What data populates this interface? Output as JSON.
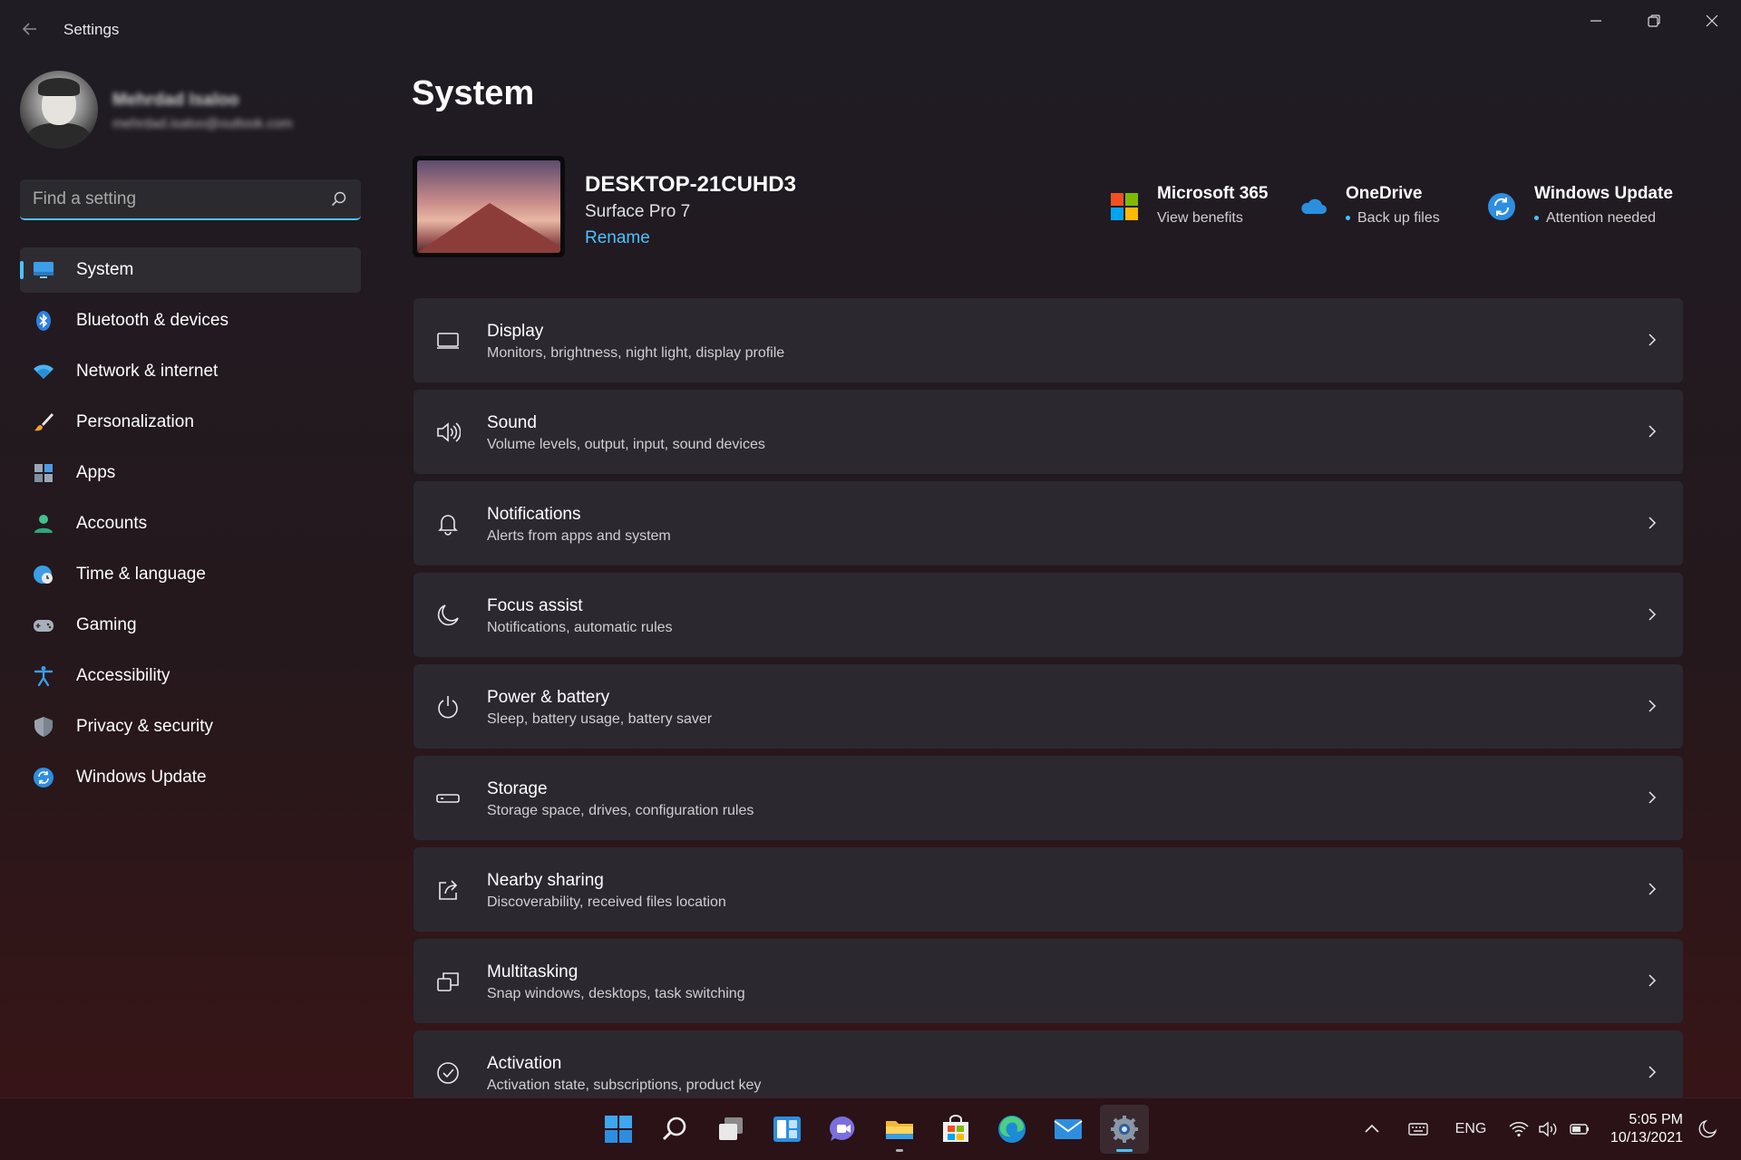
{
  "window": {
    "title": "Settings"
  },
  "profile": {
    "name": "Mehrdad Isaloo",
    "email": "mehrdad.isaloo@outlook.com"
  },
  "search": {
    "placeholder": "Find a setting",
    "value": ""
  },
  "sidebar": {
    "items": [
      {
        "label": "System",
        "icon": "system-icon",
        "active": true
      },
      {
        "label": "Bluetooth & devices",
        "icon": "bluetooth-icon"
      },
      {
        "label": "Network & internet",
        "icon": "wifi-icon"
      },
      {
        "label": "Personalization",
        "icon": "brush-icon"
      },
      {
        "label": "Apps",
        "icon": "apps-icon"
      },
      {
        "label": "Accounts",
        "icon": "account-icon"
      },
      {
        "label": "Time & language",
        "icon": "globe-clock-icon"
      },
      {
        "label": "Gaming",
        "icon": "gamepad-icon"
      },
      {
        "label": "Accessibility",
        "icon": "accessibility-icon"
      },
      {
        "label": "Privacy & security",
        "icon": "shield-icon"
      },
      {
        "label": "Windows Update",
        "icon": "update-icon"
      }
    ]
  },
  "main": {
    "title": "System",
    "device": {
      "name": "DESKTOP-21CUHD3",
      "model": "Surface Pro 7",
      "rename_label": "Rename"
    },
    "quick_links": [
      {
        "title": "Microsoft 365",
        "subtitle": "View benefits",
        "icon": "microsoft-365-icon",
        "dot": false
      },
      {
        "title": "OneDrive",
        "subtitle": "Back up files",
        "icon": "onedrive-icon",
        "dot": true
      },
      {
        "title": "Windows Update",
        "subtitle": "Attention needed",
        "icon": "windows-update-icon",
        "dot": true
      }
    ],
    "cards": [
      {
        "title": "Display",
        "subtitle": "Monitors, brightness, night light, display profile",
        "icon": "display-icon"
      },
      {
        "title": "Sound",
        "subtitle": "Volume levels, output, input, sound devices",
        "icon": "speaker-icon"
      },
      {
        "title": "Notifications",
        "subtitle": "Alerts from apps and system",
        "icon": "bell-icon"
      },
      {
        "title": "Focus assist",
        "subtitle": "Notifications, automatic rules",
        "icon": "moon-icon"
      },
      {
        "title": "Power & battery",
        "subtitle": "Sleep, battery usage, battery saver",
        "icon": "power-icon"
      },
      {
        "title": "Storage",
        "subtitle": "Storage space, drives, configuration rules",
        "icon": "storage-icon"
      },
      {
        "title": "Nearby sharing",
        "subtitle": "Discoverability, received files location",
        "icon": "share-icon"
      },
      {
        "title": "Multitasking",
        "subtitle": "Snap windows, desktops, task switching",
        "icon": "multitask-icon"
      },
      {
        "title": "Activation",
        "subtitle": "Activation state, subscriptions, product key",
        "icon": "check-circle-icon"
      }
    ]
  },
  "taskbar": {
    "apps": [
      "start-icon",
      "search-icon",
      "task-view-icon",
      "widgets-icon",
      "chat-icon",
      "file-explorer-icon",
      "store-icon",
      "edge-icon",
      "mail-icon",
      "settings-icon"
    ],
    "tray": {
      "language": "ENG",
      "time": "5:05 PM",
      "date": "10/13/2021"
    }
  },
  "colors": {
    "accent": "#4cc2ff",
    "card_bg": "#2c2830",
    "taskbar_bg": "#2a1217"
  }
}
